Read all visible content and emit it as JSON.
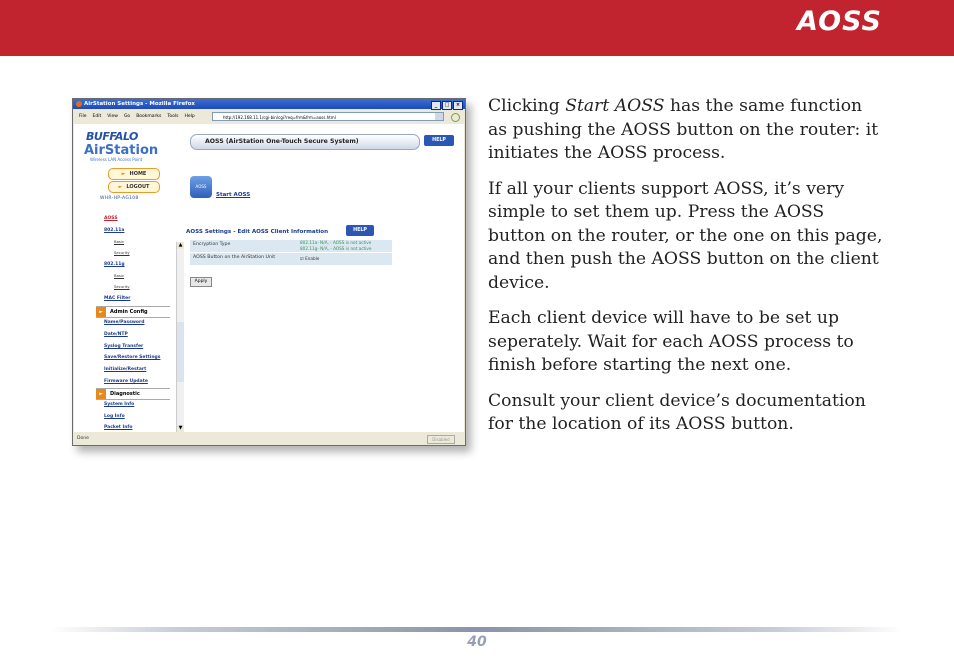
{
  "header": {
    "title": "AOSS",
    "band_color": "#c1242f"
  },
  "paragraphs": [
    {
      "before": "Clicking ",
      "emph": "Start AOSS",
      "after": " has the same function as pushing the AOSS button on the router: it initiates the AOSS process."
    },
    {
      "text": "If all your clients support AOSS, it’s very simple to set them up.  Press the AOSS button on the router, or the one on this page, and then push the AOSS button on the client device."
    },
    {
      "text": "Each client device will have to be set up seperately.  Wait for each AOSS process to finish before starting the next one."
    },
    {
      "text": "Consult your client device’s documentation for the location of its AOSS button."
    }
  ],
  "footer": {
    "page_number": "40"
  },
  "screenshot": {
    "window_title": "AirStation Settings - Mozilla Firefox",
    "window_buttons": [
      "_",
      "□",
      "×"
    ],
    "menu": [
      "File",
      "Edit",
      "View",
      "Go",
      "Bookmarks",
      "Tools",
      "Help"
    ],
    "url": "http://192.168.11.1/cgi-bin/cgi?req=frm&frm=aoss.html",
    "status_left": "Done",
    "status_right": "Disabled",
    "logo_brand": "BUFFALO",
    "logo_product": "AirStation",
    "logo_tagline": "Wireless LAN Access Point",
    "home_label": "HOME",
    "logout_label": "LOGOUT",
    "model": "WHR-HP-AG108",
    "nav": {
      "aoss": "AOSS",
      "n11a": "802.11a",
      "basic_a": "Basic",
      "security_a": "Security",
      "n11g": "802.11g",
      "basic_g": "Basic",
      "security_g": "Security",
      "mac_filter": "MAC Filter",
      "admin_config": "Admin Config",
      "name_password": "Name/Password",
      "date_ntp": "Date/NTP",
      "syslog": "Syslog Transfer",
      "save_restore": "Save/Restore Settings",
      "initialize": "Initialize/Restart",
      "firmware": "Firmware Update",
      "diagnostic": "Diagnostic",
      "system_info": "System Info",
      "log_info": "Log Info",
      "packet_info": "Packet Info"
    },
    "banner": "AOSS (AirStation One-Touch Secure System)",
    "help": "HELP",
    "aoss_icon_label": "AOSS",
    "start_aoss": "Start AOSS",
    "settings_title": "AOSS Settings - Edit AOSS Client Information",
    "table": {
      "row1_label": "Encryption Type",
      "row1_value_a": "802.11a- N/A, - AOSS is not active",
      "row1_value_g": "802.11g- N/A, - AOSS is not active",
      "row2_label": "AOSS Button on the AirStation Unit",
      "row2_value": "Enable"
    },
    "apply": "Apply"
  }
}
